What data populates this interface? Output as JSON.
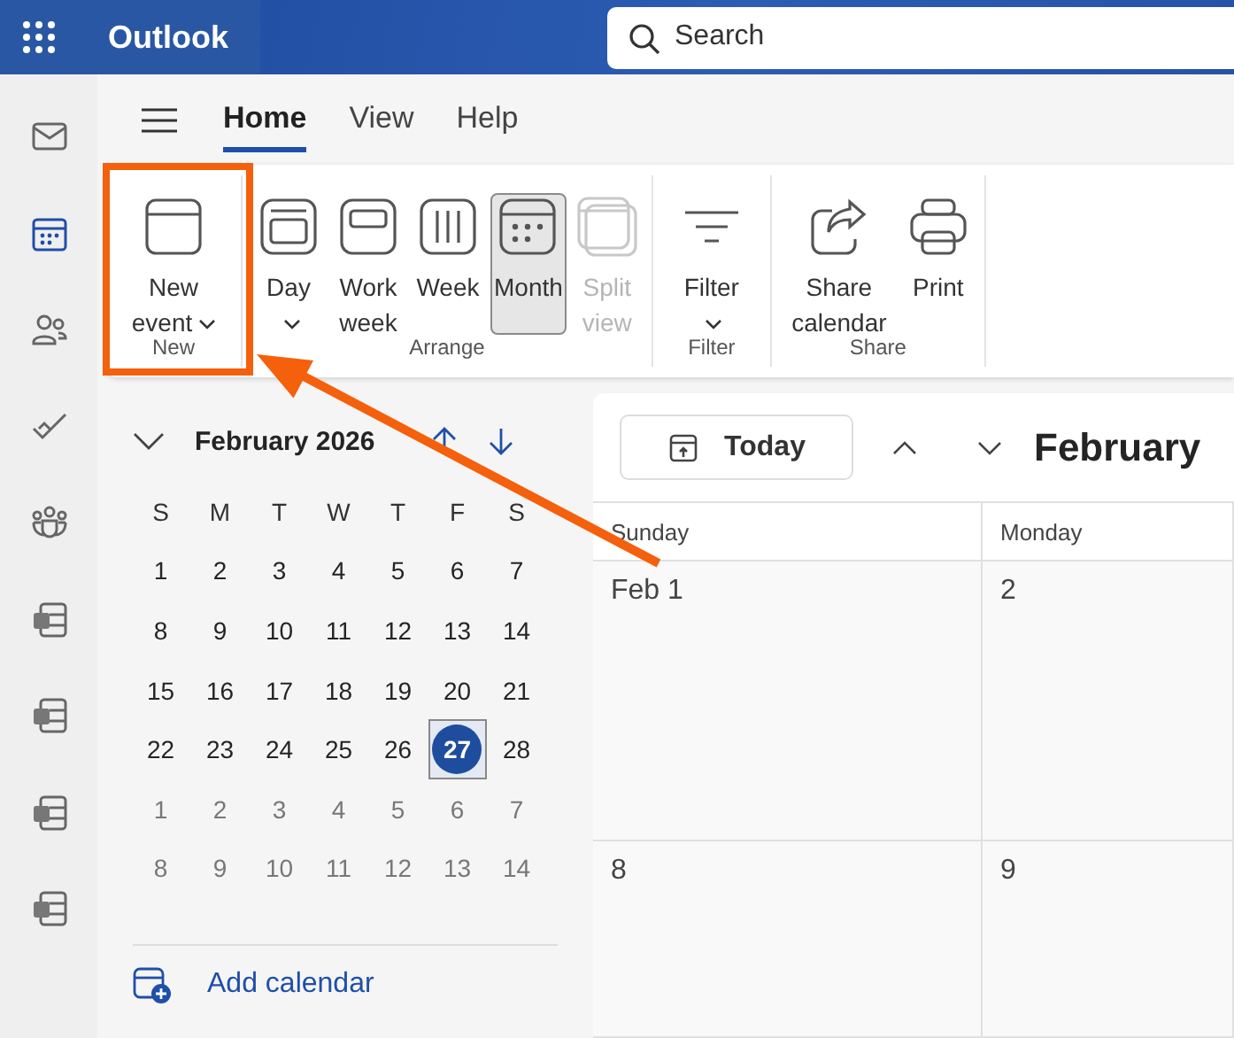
{
  "header": {
    "app_title": "Outlook",
    "search": {
      "placeholder": "Search"
    }
  },
  "rail": [
    {
      "kind": "mail",
      "selected": false
    },
    {
      "kind": "calendar",
      "selected": true
    },
    {
      "kind": "people",
      "selected": false
    },
    {
      "kind": "todo",
      "selected": false
    },
    {
      "kind": "groups",
      "selected": false
    },
    {
      "kind": "doc-w",
      "selected": false
    },
    {
      "kind": "doc-x",
      "selected": false
    },
    {
      "kind": "doc-p",
      "selected": false
    },
    {
      "kind": "doc-n",
      "selected": false
    }
  ],
  "tabs": [
    {
      "label": "Home",
      "selected": true
    },
    {
      "label": "View",
      "selected": false
    },
    {
      "label": "Help",
      "selected": false
    }
  ],
  "ribbon": [
    {
      "label": "New",
      "buttons": [
        {
          "label": "New event",
          "kind": "new-event",
          "dropdown": true,
          "selected": false,
          "disabled": false
        }
      ]
    },
    {
      "label": "Arrange",
      "buttons": [
        {
          "label": "Day",
          "kind": "day",
          "dropdown": true,
          "selected": false,
          "disabled": false
        },
        {
          "label": "Work week",
          "kind": "work-week",
          "dropdown": false,
          "selected": false,
          "disabled": false
        },
        {
          "label": "Week",
          "kind": "week",
          "dropdown": false,
          "selected": false,
          "disabled": false
        },
        {
          "label": "Month",
          "kind": "month",
          "dropdown": false,
          "selected": true,
          "disabled": false
        },
        {
          "label": "Split view",
          "kind": "split-view",
          "dropdown": false,
          "selected": false,
          "disabled": true
        }
      ]
    },
    {
      "label": "Filter",
      "buttons": [
        {
          "label": "Filter",
          "kind": "filter",
          "dropdown": true,
          "selected": false,
          "disabled": false
        }
      ]
    },
    {
      "label": "Share",
      "buttons": [
        {
          "label": "Share calendar",
          "kind": "share",
          "dropdown": false,
          "selected": false,
          "disabled": false
        },
        {
          "label": "Print",
          "kind": "print",
          "dropdown": false,
          "selected": false,
          "disabled": false
        }
      ]
    }
  ],
  "mini_calendar": {
    "title": "February 2026",
    "weekdays": [
      "S",
      "M",
      "T",
      "W",
      "T",
      "F",
      "S"
    ],
    "weeks": [
      {
        "days": [
          {
            "day": "1",
            "other_month": false,
            "selected": false
          },
          {
            "day": "2",
            "other_month": false,
            "selected": false
          },
          {
            "day": "3",
            "other_month": false,
            "selected": false
          },
          {
            "day": "4",
            "other_month": false,
            "selected": false
          },
          {
            "day": "5",
            "other_month": false,
            "selected": false
          },
          {
            "day": "6",
            "other_month": false,
            "selected": false
          },
          {
            "day": "7",
            "other_month": false,
            "selected": false
          }
        ]
      },
      {
        "days": [
          {
            "day": "8",
            "other_month": false,
            "selected": false
          },
          {
            "day": "9",
            "other_month": false,
            "selected": false
          },
          {
            "day": "10",
            "other_month": false,
            "selected": false
          },
          {
            "day": "11",
            "other_month": false,
            "selected": false
          },
          {
            "day": "12",
            "other_month": false,
            "selected": false
          },
          {
            "day": "13",
            "other_month": false,
            "selected": false
          },
          {
            "day": "14",
            "other_month": false,
            "selected": false
          }
        ]
      },
      {
        "days": [
          {
            "day": "15",
            "other_month": false,
            "selected": false
          },
          {
            "day": "16",
            "other_month": false,
            "selected": false
          },
          {
            "day": "17",
            "other_month": false,
            "selected": false
          },
          {
            "day": "18",
            "other_month": false,
            "selected": false
          },
          {
            "day": "19",
            "other_month": false,
            "selected": false
          },
          {
            "day": "20",
            "other_month": false,
            "selected": false
          },
          {
            "day": "21",
            "other_month": false,
            "selected": false
          }
        ]
      },
      {
        "days": [
          {
            "day": "22",
            "other_month": false,
            "selected": false
          },
          {
            "day": "23",
            "other_month": false,
            "selected": false
          },
          {
            "day": "24",
            "other_month": false,
            "selected": false
          },
          {
            "day": "25",
            "other_month": false,
            "selected": false
          },
          {
            "day": "26",
            "other_month": false,
            "selected": false
          },
          {
            "day": "27",
            "other_month": false,
            "selected": true
          },
          {
            "day": "28",
            "other_month": false,
            "selected": false
          }
        ]
      },
      {
        "days": [
          {
            "day": "1",
            "other_month": true,
            "selected": false
          },
          {
            "day": "2",
            "other_month": true,
            "selected": false
          },
          {
            "day": "3",
            "other_month": true,
            "selected": false
          },
          {
            "day": "4",
            "other_month": true,
            "selected": false
          },
          {
            "day": "5",
            "other_month": true,
            "selected": false
          },
          {
            "day": "6",
            "other_month": true,
            "selected": false
          },
          {
            "day": "7",
            "other_month": true,
            "selected": false
          }
        ]
      },
      {
        "days": [
          {
            "day": "8",
            "other_month": true,
            "selected": false
          },
          {
            "day": "9",
            "other_month": true,
            "selected": false
          },
          {
            "day": "10",
            "other_month": true,
            "selected": false
          },
          {
            "day": "11",
            "other_month": true,
            "selected": false
          },
          {
            "day": "12",
            "other_month": true,
            "selected": false
          },
          {
            "day": "13",
            "other_month": true,
            "selected": false
          },
          {
            "day": "14",
            "other_month": true,
            "selected": false
          }
        ]
      }
    ],
    "add_calendar": "Add calendar"
  },
  "calendar": {
    "today_button": "Today",
    "title": "February",
    "columns": [
      "Sunday",
      "Monday"
    ],
    "weeks": [
      {
        "cells": [
          "Feb 1",
          "2"
        ]
      },
      {
        "cells": [
          "8",
          "9"
        ]
      }
    ]
  }
}
